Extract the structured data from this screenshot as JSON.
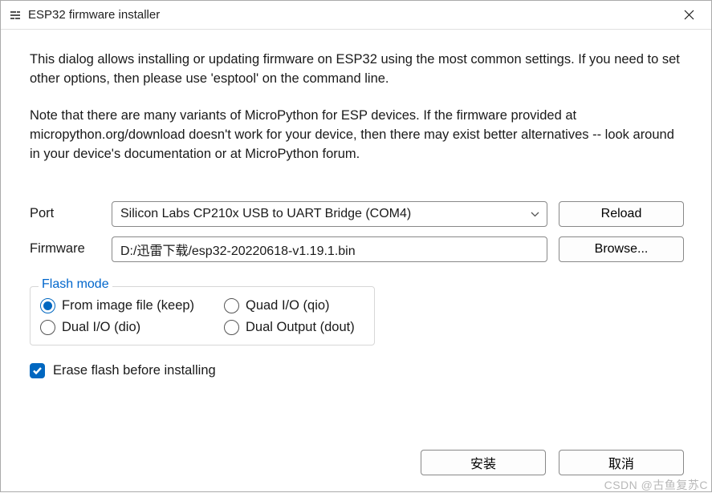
{
  "window": {
    "title": "ESP32 firmware installer"
  },
  "intro": {
    "p1": "This dialog allows installing or updating firmware on ESP32 using the most common settings. If you need to set other options, then please use 'esptool' on the command line.",
    "p2": "Note that there are many variants of MicroPython for ESP devices. If the firmware provided at micropython.org/download doesn't work for your device, then there may exist better alternatives -- look around in your device's documentation or at MicroPython forum."
  },
  "form": {
    "port_label": "Port",
    "port_value": "Silicon Labs CP210x USB to UART Bridge (COM4)",
    "reload_label": "Reload",
    "firmware_label": "Firmware",
    "firmware_value": "D:/迅雷下载/esp32-20220618-v1.19.1.bin",
    "browse_label": "Browse..."
  },
  "flash_mode": {
    "legend": "Flash mode",
    "options": [
      {
        "label": "From image file (keep)",
        "checked": true
      },
      {
        "label": "Quad I/O (qio)",
        "checked": false
      },
      {
        "label": "Dual I/O (dio)",
        "checked": false
      },
      {
        "label": "Dual Output (dout)",
        "checked": false
      }
    ]
  },
  "erase": {
    "label": "Erase flash before installing",
    "checked": true
  },
  "footer": {
    "install_label": "安装",
    "cancel_label": "取消"
  },
  "watermark": "CSDN @古鱼复苏C"
}
